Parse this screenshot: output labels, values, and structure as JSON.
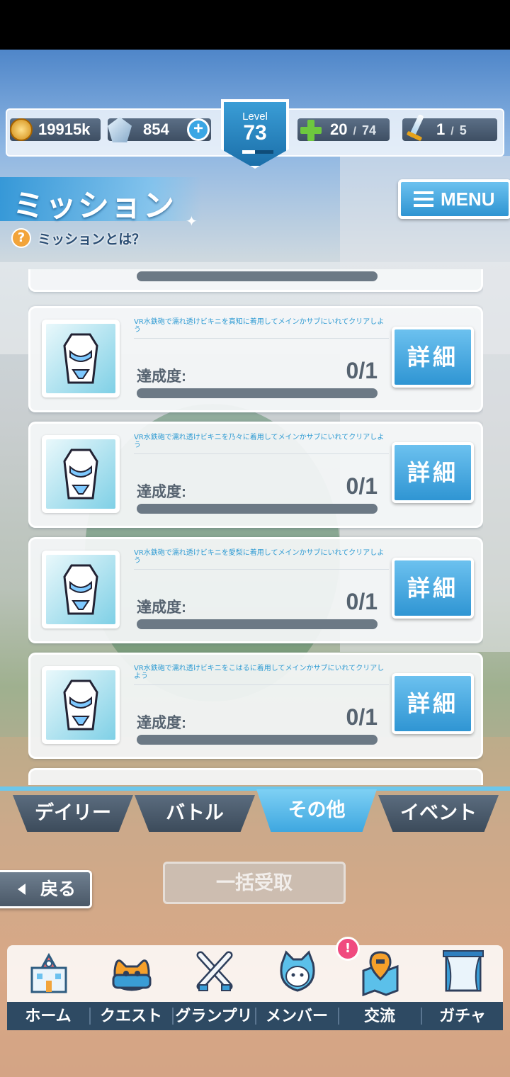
{
  "header": {
    "coins": "19915k",
    "gems": "854",
    "level_label": "Level",
    "level_value": "73",
    "level_progress": 0.4,
    "stamina_current": "20",
    "stamina_max": "74",
    "stamina_fill": 0.27,
    "battle_current": "1",
    "battle_max": "5",
    "battle_fill": 0.2,
    "plus_symbol": "+",
    "slash": "/"
  },
  "page": {
    "title": "ミッション",
    "help_icon_symbol": "?",
    "help_text": "ミッションとは？",
    "menu_label": "MENU"
  },
  "missions": [
    {
      "description": "VR水鉄砲で濡れ透けビキニを真知に着用してメインかサブにいれてクリアしよう",
      "progress_label": "達成度:",
      "progress": "0/1",
      "progress_fraction": 0,
      "detail_label": "詳細"
    },
    {
      "description": "VR水鉄砲で濡れ透けビキニを乃々に着用してメインかサブにいれてクリアしよう",
      "progress_label": "達成度:",
      "progress": "0/1",
      "progress_fraction": 0,
      "detail_label": "詳細"
    },
    {
      "description": "VR水鉄砲で濡れ透けビキニを愛梨に着用してメインかサブにいれてクリアしよう",
      "progress_label": "達成度:",
      "progress": "0/1",
      "progress_fraction": 0,
      "detail_label": "詳細"
    },
    {
      "description": "VR水鉄砲で濡れ透けビキニをこはるに着用してメインかサブにいれてクリアしよう",
      "progress_label": "達成度:",
      "progress": "0/1",
      "progress_fraction": 0,
      "detail_label": "詳細"
    }
  ],
  "tabs": [
    {
      "label": "デイリー",
      "active": false
    },
    {
      "label": "バトル",
      "active": false
    },
    {
      "label": "その他",
      "active": true
    },
    {
      "label": "イベント",
      "active": false
    }
  ],
  "actions": {
    "back_label": "戻る",
    "claim_all_label": "一括受取"
  },
  "nav": {
    "items": [
      {
        "label": "ホーム",
        "icon": "school-building-icon"
      },
      {
        "label": "クエスト",
        "icon": "monster-icon"
      },
      {
        "label": "グランプリ",
        "icon": "crossed-swords-icon"
      },
      {
        "label": "メンバー",
        "icon": "cat-hood-character-icon"
      },
      {
        "label": "交流",
        "icon": "map-pin-icon"
      },
      {
        "label": "ガチャ",
        "icon": "curtain-window-icon"
      }
    ],
    "notification_symbol": "!"
  },
  "colors": {
    "accent": "#3aa6e4",
    "button": "#2f95d3",
    "nav_bar": "#2e4a63",
    "badge": "#f04a7f"
  }
}
